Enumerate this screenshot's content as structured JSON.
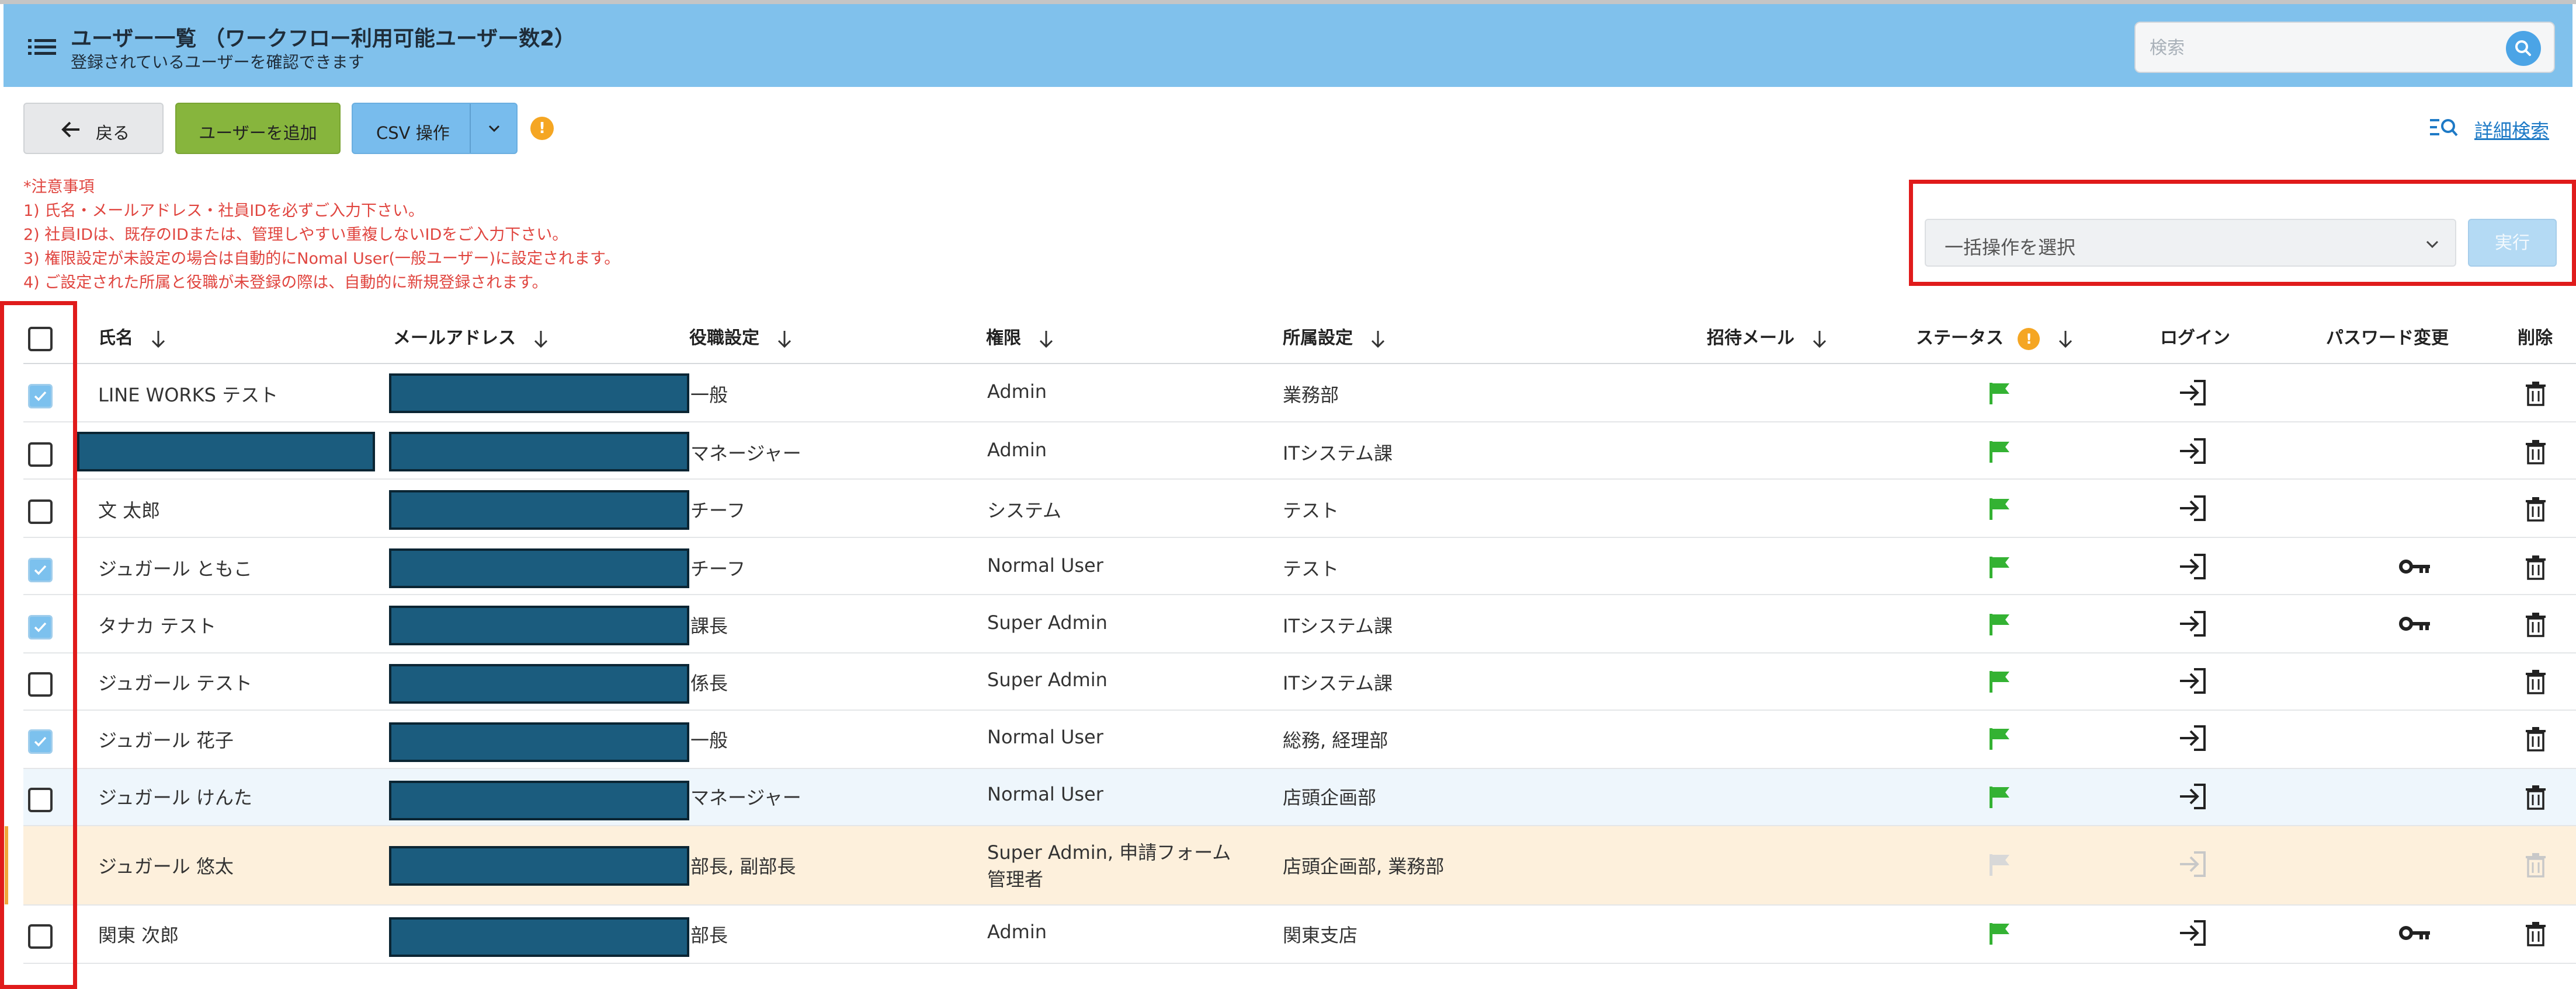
{
  "header": {
    "title": "ユーザー一覧 （ワークフロー利用可能ユーザー数2）",
    "subtitle": "登録されているユーザーを確認できます",
    "search_placeholder": "検索"
  },
  "toolbar": {
    "back_label": "戻る",
    "add_user_label": "ユーザーを追加",
    "csv_label": "CSV 操作",
    "info_mark": "!",
    "advanced_search_label": "詳細検索"
  },
  "notes": [
    "*注意事項",
    "1) 氏名・メールアドレス・社員IDを必ずご入力下さい。",
    "2) 社員IDは、既存のIDまたは、管理しやすい重複しないIDをご入力下さい。",
    "3) 権限設定が未設定の場合は自動的にNomal User(一般ユーザー)に設定されます。",
    "4) ご設定された所属と役職が未登録の際は、自動的に新規登録されます。"
  ],
  "bulk": {
    "select_label": "一括操作を選択",
    "execute_label": "実行"
  },
  "table": {
    "columns": {
      "name": "氏名",
      "email": "メールアドレス",
      "position": "役職設定",
      "role": "権限",
      "department": "所属設定",
      "invite": "招待メール",
      "status": "ステータス",
      "login": "ログイン",
      "password": "パスワード変更",
      "delete": "削除"
    },
    "rows": [
      {
        "name": "LINE WORKS テスト",
        "position": "一般",
        "role": "Admin",
        "role2": "",
        "department": "業務部"
      },
      {
        "name": "",
        "position": "マネージャー",
        "role": "Admin",
        "role2": "",
        "department": "ITシステム課"
      },
      {
        "name": "文 太郎",
        "position": "チーフ",
        "role": "システム",
        "role2": "",
        "department": "テスト"
      },
      {
        "name": "ジュガール ともこ",
        "position": "チーフ",
        "role": "Normal User",
        "role2": "",
        "department": "テスト"
      },
      {
        "name": "タナカ テスト",
        "position": "課長",
        "role": "Super Admin",
        "role2": "",
        "department": "ITシステム課"
      },
      {
        "name": "ジュガール テスト",
        "position": "係長",
        "role": "Super Admin",
        "role2": "",
        "department": "ITシステム課"
      },
      {
        "name": "ジュガール 花子",
        "position": "一般",
        "role": "Normal User",
        "role2": "",
        "department": "総務, 経理部"
      },
      {
        "name": "ジュガール けんた",
        "position": "マネージャー",
        "role": "Normal User",
        "role2": "",
        "department": "店頭企画部"
      },
      {
        "name": "ジュガール 悠太",
        "position": "部長, 副部長",
        "role": "Super Admin, 申請フォーム",
        "role2": "管理者",
        "department": "店頭企画部, 業務部"
      },
      {
        "name": "関東 次郎",
        "position": "部長",
        "role": "Admin",
        "role2": "",
        "department": "関東支店"
      }
    ]
  },
  "colors": {
    "header_bg": "#80c1ec",
    "add_button": "#87b53d",
    "csv_button": "#78bced",
    "notes_text": "#e0453f",
    "highlight_border": "#e01b1b",
    "status_flag_active": "#34b233",
    "redaction": "#1b5c7e"
  }
}
